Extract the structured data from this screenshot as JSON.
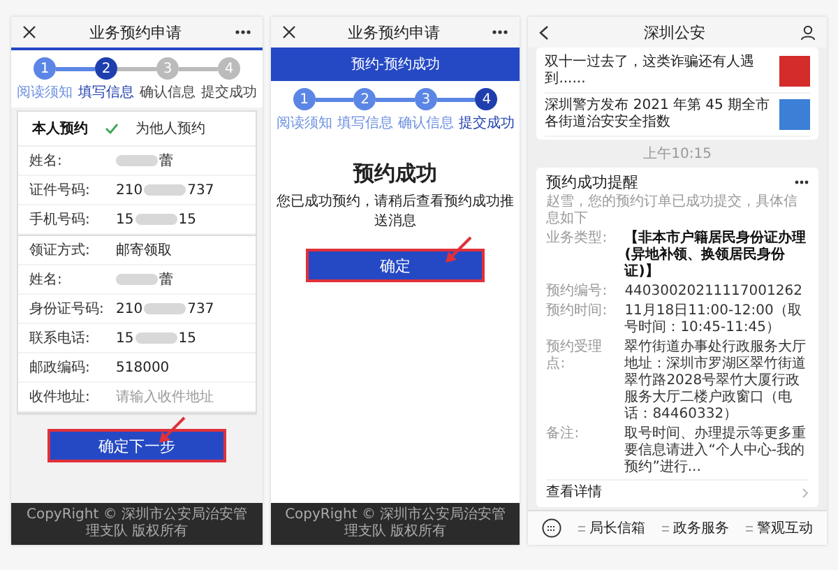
{
  "screens": [
    {
      "kind": "form",
      "header": {
        "title": "业务预约申请"
      },
      "steps": [
        {
          "number": "1",
          "label": "阅读须知",
          "completed": true,
          "current": false
        },
        {
          "number": "2",
          "label": "填写信息",
          "completed": false,
          "current": true
        },
        {
          "number": "3",
          "label": "确认信息",
          "completed": false,
          "current": false
        },
        {
          "number": "4",
          "label": "提交成功",
          "completed": false,
          "current": false
        }
      ],
      "booking_options": [
        {
          "label": "本人预约",
          "selected": true
        },
        {
          "label": "为他人预约",
          "selected": false
        }
      ],
      "sections": [
        [
          {
            "label": "姓名:",
            "kind": "masked",
            "visible_end": "蕾"
          },
          {
            "label": "证件号码:",
            "kind": "masked",
            "visible_start": "210",
            "visible_end": "737"
          },
          {
            "label": "手机号码:",
            "kind": "masked",
            "visible_start": "15",
            "visible_end": "15"
          }
        ],
        [
          {
            "label": "领证方式:",
            "kind": "text",
            "value": "邮寄领取"
          },
          {
            "label": "姓名:",
            "kind": "masked",
            "visible_end": "蕾"
          },
          {
            "label": "身份证号码:",
            "kind": "masked",
            "visible_start": "210",
            "visible_end": "737"
          },
          {
            "label": "联系电话:",
            "kind": "masked",
            "visible_start": "15",
            "visible_end": "15"
          },
          {
            "label": "邮政编码:",
            "kind": "text",
            "value": "518000"
          },
          {
            "label": "收件地址:",
            "kind": "input",
            "placeholder": "请输入收件地址"
          }
        ]
      ],
      "button": {
        "label": "确定下一步",
        "annotated": true
      },
      "footer": "CopyRight © 深圳市公安局治安管理支队 版权所有"
    },
    {
      "kind": "success",
      "header": {
        "title": "业务预约申请"
      },
      "banner": "预约-预约成功",
      "steps": [
        {
          "number": "1",
          "label": "阅读须知",
          "completed": true,
          "current": false
        },
        {
          "number": "2",
          "label": "填写信息",
          "completed": true,
          "current": false
        },
        {
          "number": "3",
          "label": "确认信息",
          "completed": true,
          "current": false
        },
        {
          "number": "4",
          "label": "提交成功",
          "completed": false,
          "current": true
        }
      ],
      "title": "预约成功",
      "message": "您已成功预约，请稍后查看预约成功推送消息",
      "button": {
        "label": "确定",
        "annotated": true
      },
      "footer": "CopyRight © 深圳市公安局治安管理支队 版权所有"
    },
    {
      "kind": "chat",
      "header": {
        "title": "深圳公安"
      },
      "news": [
        {
          "title": "双十一过去了，这类诈骗还有人遇到......",
          "color": "#d42b2b"
        },
        {
          "title": "深圳警方发布 2021 年第 45 期全市各街道治安安全指数",
          "color": "#3b7fd6"
        }
      ],
      "timestamp": "上午10:15",
      "card": {
        "title": "预约成功提醒",
        "greeting": "赵雪，您的预约订单已成功提交，具体信息如下",
        "details": [
          {
            "label": "业务类型:",
            "value": "【非本市户籍居民身份证办理(异地补领、换领居民身份证)】",
            "emphasis": true
          },
          {
            "label": "预约编号:",
            "value": "44030020211117001262",
            "emphasis": false
          },
          {
            "label": "预约时间:",
            "value": "11月18日11:00-12:00（取号时间：10:45-11:45）",
            "emphasis": false
          },
          {
            "label": "预约受理点:",
            "value": "翠竹街道办事处行政服务大厅地址：深圳市罗湖区翠竹街道翠竹路2028号翠竹大厦行政服务大厅二楼户政窗口（电话：84460332）",
            "emphasis": false
          },
          {
            "label": "备注:",
            "value": "取号时间、办理提示等更多重要信息请进入“个人中心-我的预约”进行...",
            "emphasis": false
          }
        ],
        "link": "查看详情"
      },
      "menu": [
        {
          "label": "局长信箱"
        },
        {
          "label": "政务服务"
        },
        {
          "label": "警观互动"
        }
      ]
    }
  ]
}
